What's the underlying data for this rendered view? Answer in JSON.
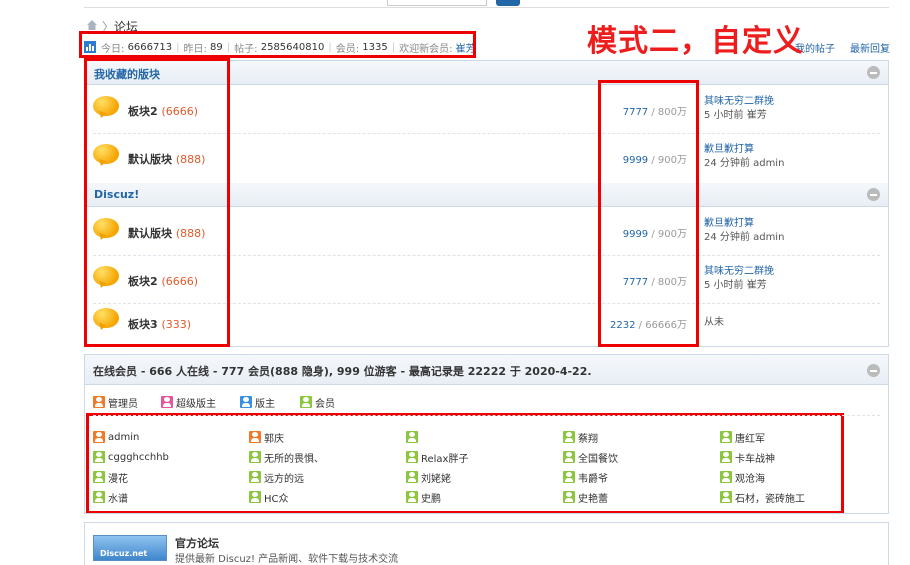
{
  "breadcrumb": {
    "current": "论坛"
  },
  "stats": {
    "today_label": "今日:",
    "today": "6666713",
    "yesterday_label": "昨日:",
    "yesterday": "89",
    "posts_label": "帖子:",
    "posts": "2585640810",
    "members_label": "会员:",
    "members": "1335",
    "welcome_label": "欢迎新会员:",
    "newest_member": "崔芳"
  },
  "top_links": {
    "left": "我的帖子",
    "right": "最新回复"
  },
  "annotation": "模式二，自定义",
  "categories": [
    {
      "title": "我收藏的版块",
      "forums": [
        {
          "name": "板块2",
          "count": "(6666)",
          "threads": "7777",
          "posts": "800万",
          "last_title": "其味无穷二群挽",
          "last_time": "5 小时前",
          "last_user": "崔芳"
        },
        {
          "name": "默认版块",
          "count": "(888)",
          "threads": "9999",
          "posts": "900万",
          "last_title": "歉旦歉打算",
          "last_time": "24 分钟前",
          "last_user": "admin"
        }
      ]
    },
    {
      "title": "Discuz!",
      "forums": [
        {
          "name": "默认版块",
          "count": "(888)",
          "threads": "9999",
          "posts": "900万",
          "last_title": "歉旦歉打算",
          "last_time": "24 分钟前",
          "last_user": "admin"
        },
        {
          "name": "板块2",
          "count": "(6666)",
          "threads": "7777",
          "posts": "800万",
          "last_title": "其味无穷二群挽",
          "last_time": "5 小时前",
          "last_user": "崔芳"
        },
        {
          "name": "板块3",
          "count": "(333)",
          "threads": "2232",
          "posts": "66666万",
          "last_title": "从未",
          "last_time": "",
          "last_user": ""
        }
      ]
    }
  ],
  "online": {
    "title": "在线会员 - 666 人在线 - 777 会员(888 隐身), 999 位游客 - 最高记录是 22222 于 2020-4-22.",
    "legend": [
      {
        "label": "管理员",
        "role": "admin"
      },
      {
        "label": "超级版主",
        "role": "super"
      },
      {
        "label": "版主",
        "role": "mod"
      },
      {
        "label": "会员",
        "role": "member"
      }
    ],
    "members": [
      {
        "name": "admin",
        "role": "admin"
      },
      {
        "name": "郭庆",
        "role": "admin"
      },
      {
        "name": "",
        "role": "member"
      },
      {
        "name": "蔡翔",
        "role": "member"
      },
      {
        "name": "唐红军",
        "role": "member"
      },
      {
        "name": "cggghcchhb",
        "role": "member"
      },
      {
        "name": "无所的畏惧、",
        "role": "member"
      },
      {
        "name": "Relax胖子",
        "role": "member"
      },
      {
        "name": "全国餐饮",
        "role": "member"
      },
      {
        "name": "卡车战神",
        "role": "member"
      },
      {
        "name": "漫花",
        "role": "member"
      },
      {
        "name": "远方的远",
        "role": "member"
      },
      {
        "name": "刘姥姥",
        "role": "member"
      },
      {
        "name": "韦爵爷",
        "role": "member"
      },
      {
        "name": "观沧海",
        "role": "member"
      },
      {
        "name": "水谱",
        "role": "member"
      },
      {
        "name": "HC众",
        "role": "member"
      },
      {
        "name": "史鹏",
        "role": "member"
      },
      {
        "name": "史艳蕾",
        "role": "member"
      },
      {
        "name": "石材，瓷砖施工",
        "role": "member"
      }
    ]
  },
  "official": {
    "logo_text": "Discuz.net",
    "title": "官方论坛",
    "desc": "提供最新 Discuz! 产品新闻、软件下载与技术交流"
  },
  "colors": {
    "link": "#2366a8",
    "annotation_red": "#ee1c1c",
    "count_orange": "#e05a2b"
  }
}
